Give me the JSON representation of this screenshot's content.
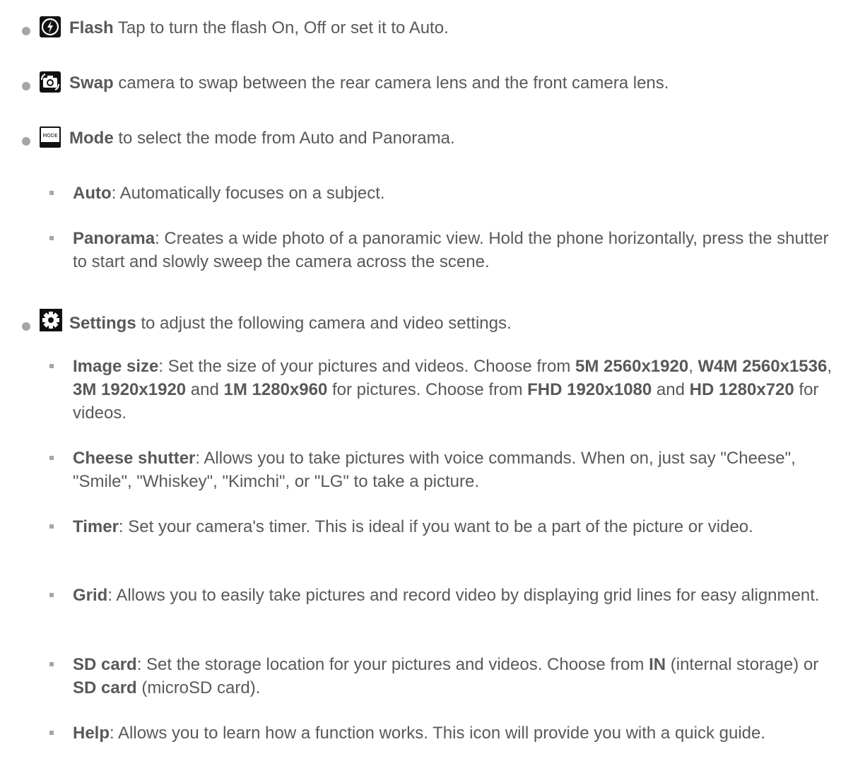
{
  "items": [
    {
      "title": "Flash",
      "text": " Tap to turn the flash On, Off or set it to Auto.",
      "icon": "flash-icon"
    },
    {
      "title": "Swap",
      "text": " camera to swap between the rear camera lens and the front camera lens.",
      "icon": "swap-camera-icon"
    },
    {
      "title": "Mode",
      "text": " to select the mode from Auto and Panorama.",
      "icon": "mode-icon",
      "icon_label": "MODE",
      "sub": [
        {
          "title": "Auto",
          "text": ": Automatically focuses on a subject."
        },
        {
          "title": "Panorama",
          "text": ": Creates a wide photo of a panoramic view. Hold the phone horizontally, press the shutter to start and slowly sweep the camera across the scene."
        }
      ]
    },
    {
      "title": "Settings",
      "text": " to adjust the following camera and video settings.",
      "icon": "settings-gear-icon",
      "sub": [
        {
          "title": "Image size",
          "p1": ": Set the size of your pictures and videos. Choose from ",
          "b1": "5M 2560x1920",
          "p2": ", ",
          "b2": "W4M 2560x1536",
          "p3": ", ",
          "b3": "3M 1920x1920",
          "p4": " and ",
          "b4": "1M 1280x960",
          "p5": " for pictures. Choose from ",
          "b5": "FHD 1920x1080",
          "p6": " and ",
          "b6": "HD 1280x720",
          "p7": " for videos."
        },
        {
          "title": "Cheese shutter",
          "text": ": Allows you to take pictures with voice commands. When on, just say \"Cheese\", \"Smile\", \"Whiskey\", \"Kimchi\", or \"LG\" to take a picture."
        },
        {
          "title": "Timer",
          "text": ": Set your camera's timer. This is ideal if you want to be a part of the picture or video."
        },
        {
          "title": "Grid",
          "text": ": Allows you to easily take pictures and record video by displaying grid lines for easy alignment."
        },
        {
          "title": "SD card",
          "p1": ": Set the storage location for your pictures and videos. Choose from ",
          "b1": "IN",
          "p2": " (internal storage) or ",
          "b2": "SD card",
          "p3": " (microSD card)."
        },
        {
          "title": "Help",
          "text": ": Allows you to learn how a function works. This icon will provide you with a quick guide."
        }
      ]
    }
  ]
}
